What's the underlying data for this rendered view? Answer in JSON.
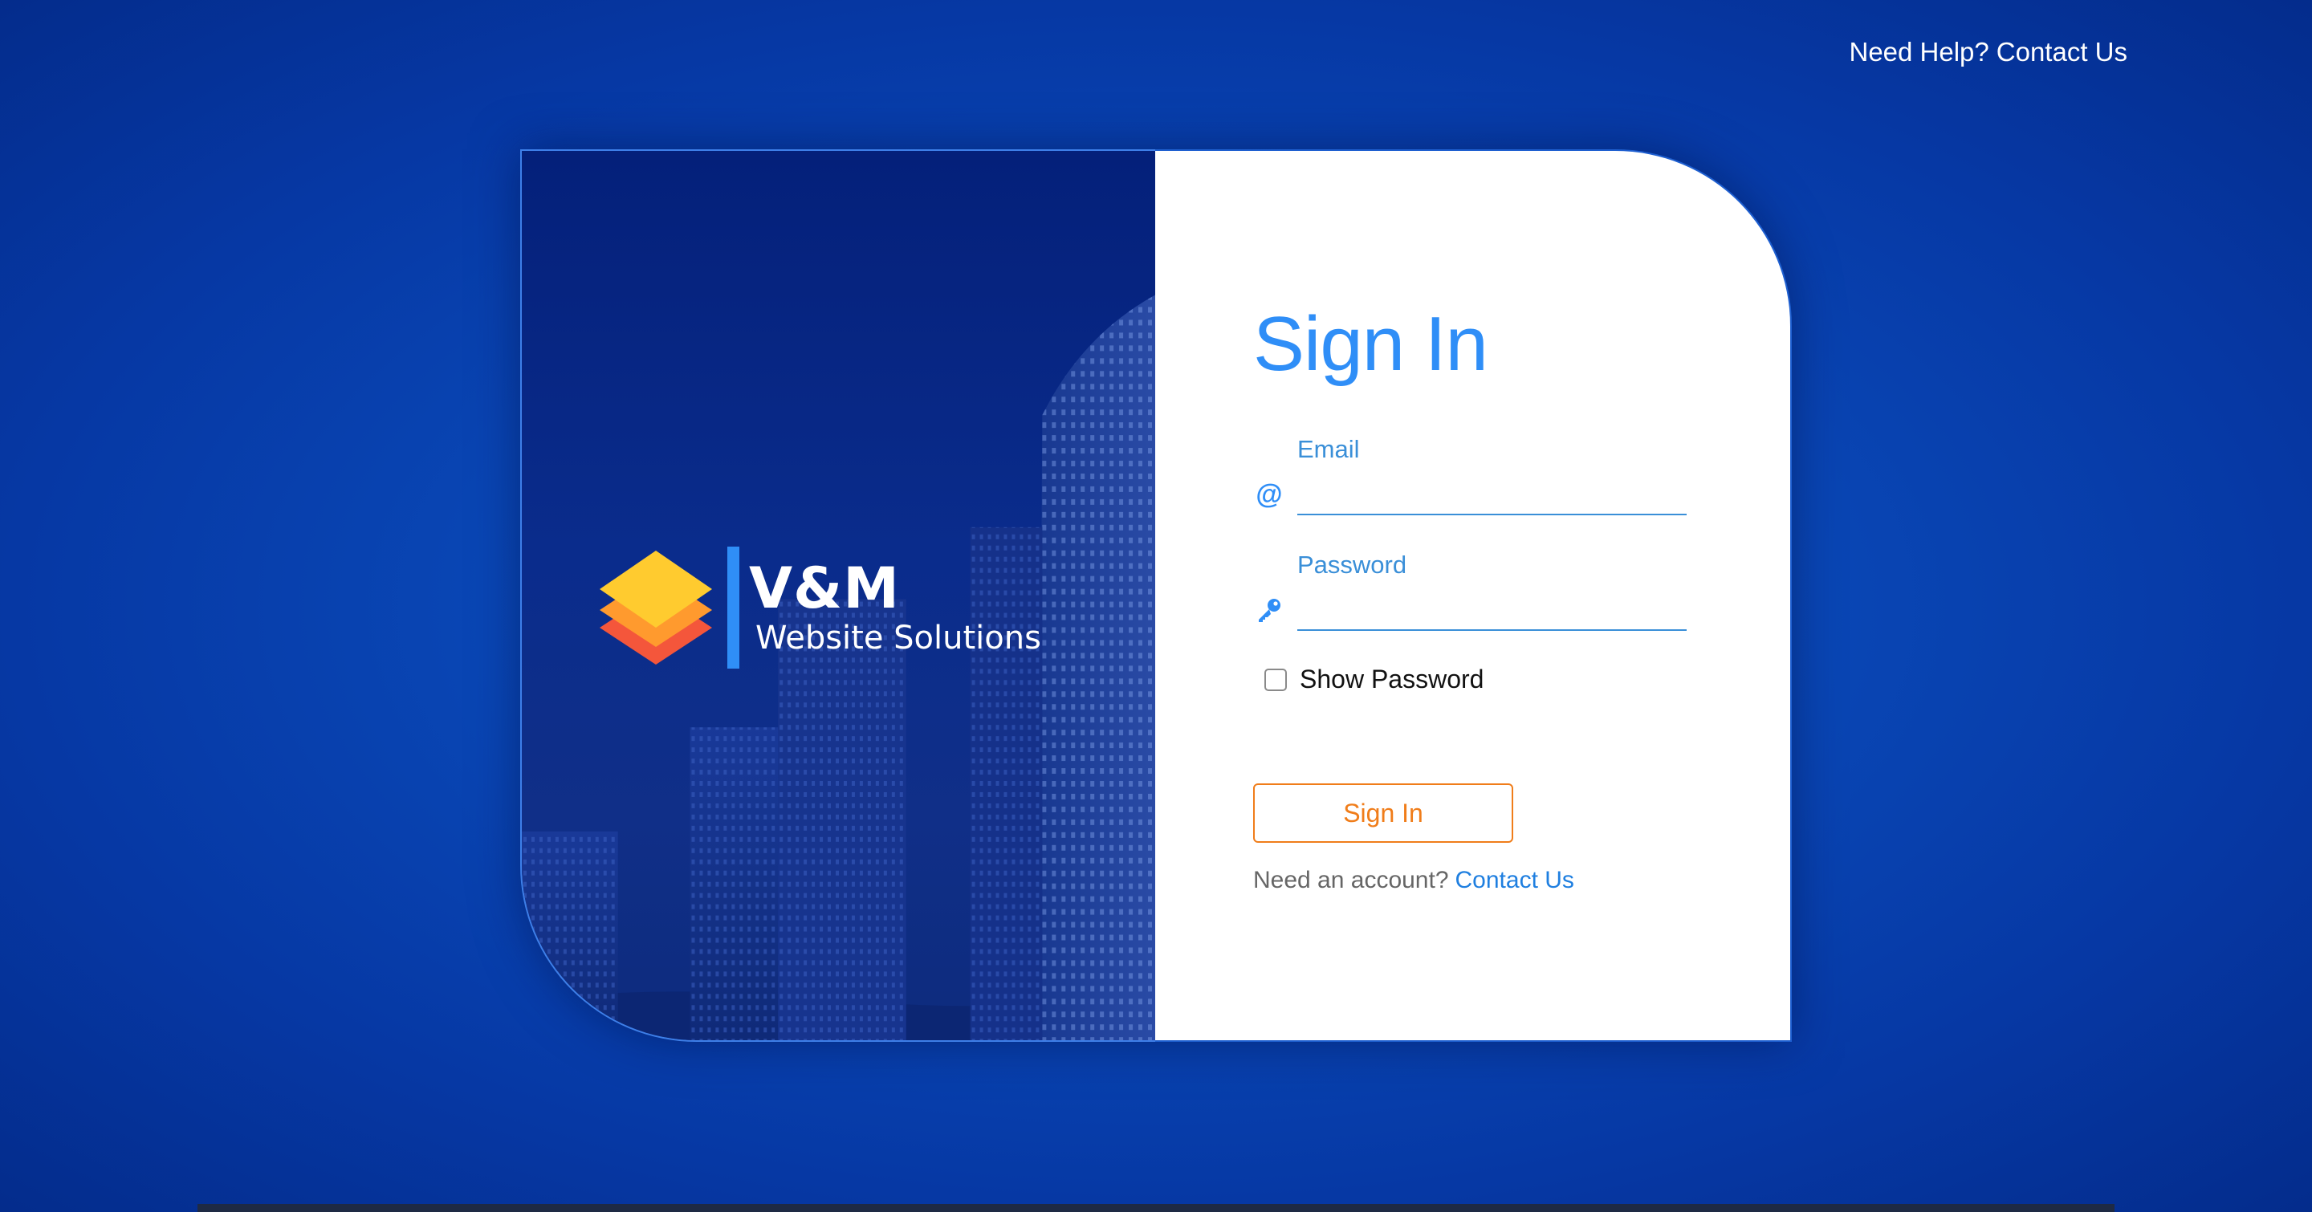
{
  "header": {
    "help_prefix": "Need Help?",
    "help_link": "Contact Us"
  },
  "brand": {
    "title": "V&M",
    "subtitle": "Website Solutions",
    "colors": {
      "diamond_top": "#ffcb2f",
      "diamond_mid": "#ff9a2e",
      "diamond_bottom": "#f4563b",
      "divider": "#2f8ef7"
    }
  },
  "form": {
    "title": "Sign In",
    "email": {
      "label": "Email",
      "icon": "at-icon",
      "value": "",
      "placeholder": ""
    },
    "password": {
      "label": "Password",
      "icon": "key-icon",
      "value": "",
      "placeholder": ""
    },
    "show_password": {
      "label": "Show Password",
      "checked": false
    },
    "submit_label": "Sign In",
    "account_prompt": "Need an account?",
    "account_link": "Contact Us"
  },
  "theme": {
    "background": "#0a49b8",
    "accent": "#2f8ef7",
    "button": "#f07d1a",
    "link": "#1f7fe0"
  }
}
